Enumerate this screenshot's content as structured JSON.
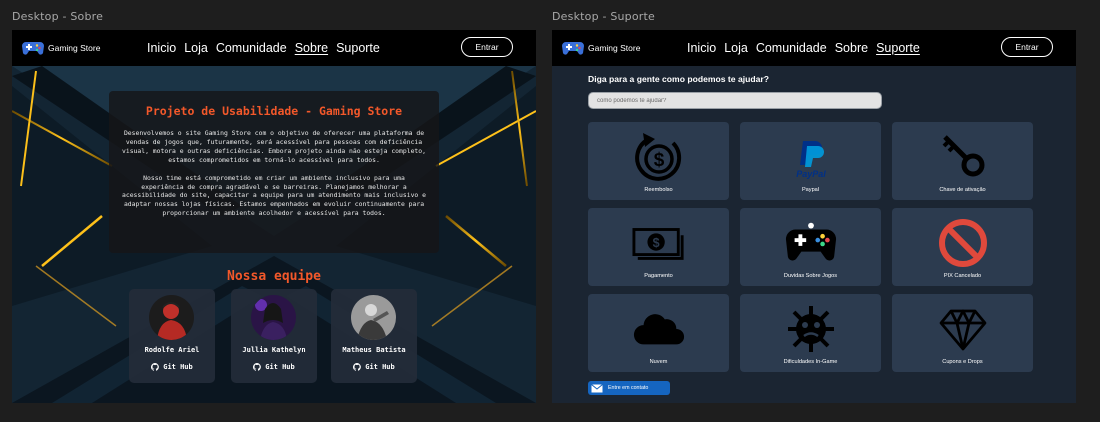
{
  "frames": {
    "sobre_label": "Desktop - Sobre",
    "suporte_label": "Desktop - Suporte"
  },
  "nav": {
    "logo_text": "Gaming Store",
    "links": [
      "Inicio",
      "Loja",
      "Comunidade",
      "Sobre",
      "Suporte"
    ],
    "login_label": "Entrar"
  },
  "sobre": {
    "active_link": "Sobre",
    "project_title": "Projeto de Usabilidade - Gaming Store",
    "paragraph1": "Desenvolvemos o site Gaming Store com o objetivo de oferecer uma plataforma de vendas de jogos que, futuramente, será acessível para pessoas com deficiência visual, motora e outras deficiências. Embora projeto ainda não esteja completo, estamos comprometidos em torná-lo acessível para todos.",
    "paragraph2": "Nosso time está comprometido em criar um ambiente inclusivo para uma experiência de compra agradável e se barreiras. Planejamos melhorar a acessibilidade do site, capacitar a equipe para um atendimento mais inclusivo e adaptar nossas lojas físicas. Estamos empenhados em evoluir continuamente para proporcionar um ambiente acolhedor e acessível para todos.",
    "team_title": "Nossa equipe",
    "members": [
      {
        "name": "Rodolfe Ariel",
        "link": "Git Hub"
      },
      {
        "name": "Jullia Kathelyn",
        "link": "Git Hub"
      },
      {
        "name": "Matheus Batista",
        "link": "Git Hub"
      }
    ]
  },
  "suporte": {
    "active_link": "Suporte",
    "title": "Diga para a gente como podemos te ajudar?",
    "search_placeholder": "como podemos te ajudar?",
    "tiles": [
      {
        "label": "Reembolso",
        "icon": "refund-dollar-icon"
      },
      {
        "label": "Paypal",
        "icon": "paypal-icon",
        "icon_text": "PayPal"
      },
      {
        "label": "Chave de ativação",
        "icon": "key-icon"
      },
      {
        "label": "Pagamento",
        "icon": "money-icon"
      },
      {
        "label": "Duvidas Sobre Jogos",
        "icon": "gamepad-icon"
      },
      {
        "label": "PIX Cancelado",
        "icon": "forbidden-icon"
      },
      {
        "label": "Nuvem",
        "icon": "cloud-icon"
      },
      {
        "label": "Dificuldades In-Game",
        "icon": "virus-icon"
      },
      {
        "label": "Cupons e Drops",
        "icon": "diamond-icon"
      }
    ],
    "contact_label": "Entre em contato"
  },
  "colors": {
    "accent": "#f3582a",
    "tile": "#2c3b4f",
    "contact": "#1565c0",
    "forbidden": "#e0493c"
  }
}
